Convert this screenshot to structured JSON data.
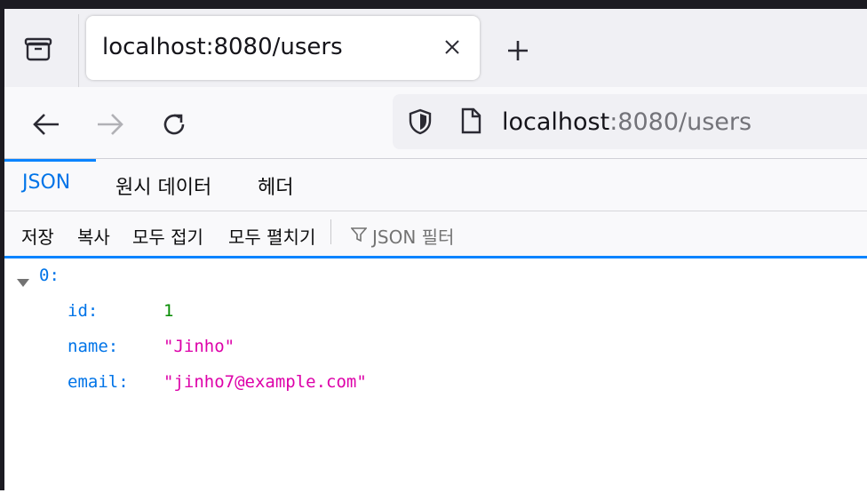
{
  "browser": {
    "tab": {
      "title": "localhost:8080/users",
      "close_icon": "close-icon"
    },
    "new_tab_icon": "plus-icon",
    "overview_icon": "tab-overview-icon"
  },
  "nav": {
    "back_icon": "back-arrow-icon",
    "forward_icon": "forward-arrow-icon",
    "reload_icon": "reload-icon",
    "url_host": "localhost",
    "url_rest": ":8080/users",
    "shield_icon": "shield-icon",
    "page_icon": "page-icon"
  },
  "viewer": {
    "tabs": [
      {
        "label": "JSON",
        "active": true
      },
      {
        "label": "원시 데이터",
        "active": false
      },
      {
        "label": "헤더",
        "active": false
      }
    ],
    "toolbar": {
      "save": "저장",
      "copy": "복사",
      "collapse_all": "모두 접기",
      "expand_all": "모두 펼치기",
      "filter_placeholder": "JSON 필터"
    },
    "tree": {
      "root_key": "0:",
      "fields": [
        {
          "key": "id:",
          "value": "1",
          "type": "number"
        },
        {
          "key": "name:",
          "value": "\"Jinho\"",
          "type": "string"
        },
        {
          "key": "email:",
          "value": "\"jinho7@example.com\"",
          "type": "string"
        }
      ]
    }
  },
  "colors": {
    "accent": "#0a84ff",
    "key": "#0074e8",
    "number": "#058b00",
    "string": "#dd00a9"
  }
}
